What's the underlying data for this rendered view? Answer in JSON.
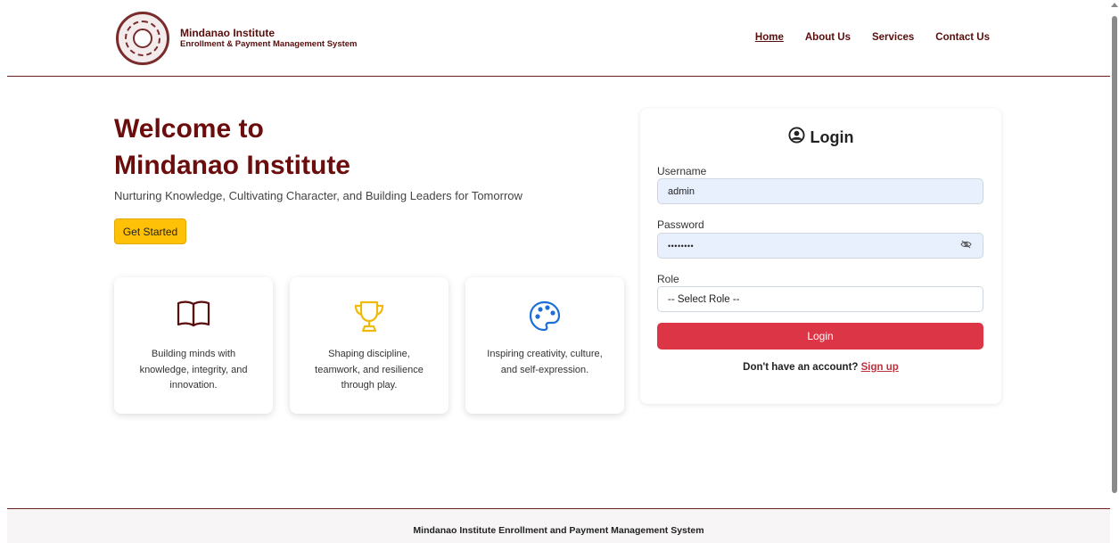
{
  "header": {
    "brand_name": "Mindanao Institute",
    "brand_sub": "Enrollment & Payment Management System",
    "nav": [
      "Home",
      "About Us",
      "Services",
      "Contact Us"
    ]
  },
  "hero": {
    "title_line1": "Welcome to",
    "title_line2": "Mindanao Institute",
    "subtitle": "Nurturing Knowledge, Cultivating Character, and Building Leaders for Tomorrow",
    "cta": "Get Started"
  },
  "cards": [
    {
      "icon": "book-icon",
      "text": "Building minds with knowledge, integrity, and innovation."
    },
    {
      "icon": "trophy-icon",
      "text": "Shaping discipline, teamwork, and resilience through play."
    },
    {
      "icon": "palette-icon",
      "text": "Inspiring creativity, culture, and self-expression."
    }
  ],
  "login": {
    "title": "Login",
    "username_label": "Username",
    "username_value": "admin",
    "password_label": "Password",
    "password_value": "••••••••",
    "role_label": "Role",
    "role_value": "-- Select Role --",
    "button": "Login",
    "signup_prompt": "Don't have an account?",
    "signup_link": "Sign up"
  },
  "footer": {
    "text": "Mindanao Institute Enrollment and Payment Management System"
  },
  "colors": {
    "brand": "#6b0d0d",
    "accent_yellow": "#ffc107",
    "login_red": "#dc3545",
    "icon_gold": "#f0b90b",
    "icon_blue": "#1d6fd8"
  }
}
